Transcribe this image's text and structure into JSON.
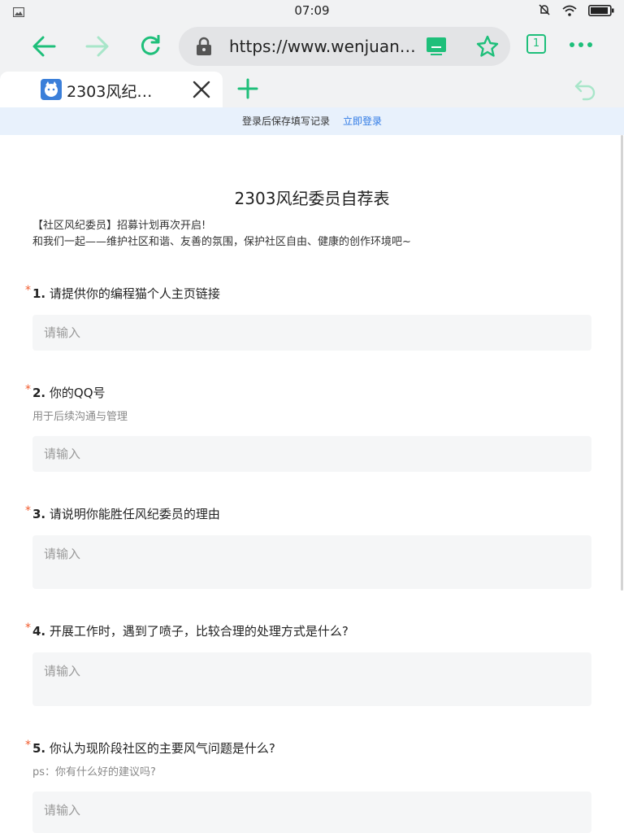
{
  "status_bar": {
    "time": "07:09",
    "icons": [
      "gallery-icon",
      "mute-icon",
      "wifi-icon",
      "battery-icon"
    ]
  },
  "toolbar": {
    "url": "https://www.wenjuan…",
    "tab_count": "1",
    "accent_color": "#1ebf7a"
  },
  "tab": {
    "title": "2303风纪…"
  },
  "banner": {
    "text": "登录后保存填写记录",
    "login_link": "立即登录"
  },
  "form": {
    "title": "2303风纪委员自荐表",
    "intro_line1": "【社区风纪委员】招募计划再次开启!",
    "intro_line2": "和我们一起——维护社区和谐、友善的氛围，保护社区自由、健康的创作环境吧~",
    "required_mark": "*",
    "questions": [
      {
        "number": "1.",
        "text": "请提供你的编程猫个人主页链接",
        "hint": "",
        "placeholder": "请输入"
      },
      {
        "number": "2.",
        "text": "你的QQ号",
        "hint": "用于后续沟通与管理",
        "placeholder": "请输入"
      },
      {
        "number": "3.",
        "text": "请说明你能胜任风纪委员的理由",
        "hint": "",
        "placeholder": "请输入"
      },
      {
        "number": "4.",
        "text": "开展工作时，遇到了喷子，比较合理的处理方式是什么?",
        "hint": "",
        "placeholder": "请输入"
      },
      {
        "number": "5.",
        "text": "你认为现阶段社区的主要风气问题是什么?",
        "hint": "ps：你有什么好的建议吗?",
        "placeholder": "请输入"
      }
    ]
  }
}
